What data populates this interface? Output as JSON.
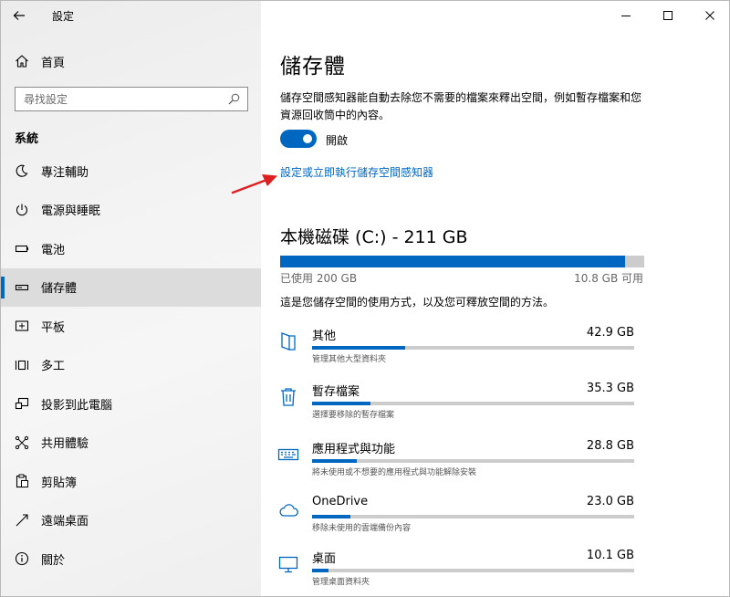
{
  "window": {
    "title": "設定"
  },
  "sidebar": {
    "home_label": "首頁",
    "search_placeholder": "尋找設定",
    "section_title": "系統",
    "items": [
      {
        "label": "專注輔助",
        "icon": "focus-assist-icon"
      },
      {
        "label": "電源與睡眠",
        "icon": "power-icon"
      },
      {
        "label": "電池",
        "icon": "battery-icon"
      },
      {
        "label": "儲存體",
        "icon": "storage-icon",
        "selected": true
      },
      {
        "label": "平板",
        "icon": "tablet-icon"
      },
      {
        "label": "多工",
        "icon": "multitasking-icon"
      },
      {
        "label": "投影到此電腦",
        "icon": "projecting-icon"
      },
      {
        "label": "共用體驗",
        "icon": "shared-experiences-icon"
      },
      {
        "label": "剪貼簿",
        "icon": "clipboard-icon"
      },
      {
        "label": "遠端桌面",
        "icon": "remote-desktop-icon"
      },
      {
        "label": "關於",
        "icon": "info-icon"
      }
    ]
  },
  "main": {
    "page_title": "儲存體",
    "description": "儲存空間感知器能自動去除您不需要的檔案來釋出空間，例如暫存檔案和您資源回收筒中的內容。",
    "toggle_label": "開啟",
    "toggle_on": true,
    "link_text": "設定或立即執行儲存空間感知器",
    "drive": {
      "title": "本機磁碟 (C:) - 211 GB",
      "used_label": "已使用 200 GB",
      "free_label": "10.8 GB 可用",
      "used_fraction": 0.947
    },
    "usage_description": "這是您儲存空間的使用方式，以及您可釋放空間的方法。",
    "categories": [
      {
        "name": "其他",
        "size": "42.9 GB",
        "desc": "管理其他大型資料夾",
        "fraction": 0.29,
        "icon": "other-folder-icon"
      },
      {
        "name": "暫存檔案",
        "size": "35.3 GB",
        "desc": "選擇要移除的暫存檔案",
        "fraction": 0.18,
        "icon": "trash-icon"
      },
      {
        "name": "應用程式與功能",
        "size": "28.8 GB",
        "desc": "將未使用或不想要的應用程式與功能解除安裝",
        "fraction": 0.14,
        "icon": "apps-keyboard-icon"
      },
      {
        "name": "OneDrive",
        "size": "23.0 GB",
        "desc": "移除未使用的雲端備份內容",
        "fraction": 0.12,
        "icon": "cloud-icon"
      },
      {
        "name": "桌面",
        "size": "10.1 GB",
        "desc": "管理桌面資料夾",
        "fraction": 0.05,
        "icon": "desktop-icon"
      }
    ]
  },
  "colors": {
    "accent": "#0067c0",
    "bar_track": "#cccccc",
    "selection": "#dcdcdc",
    "annotation_arrow": "#e02020"
  }
}
